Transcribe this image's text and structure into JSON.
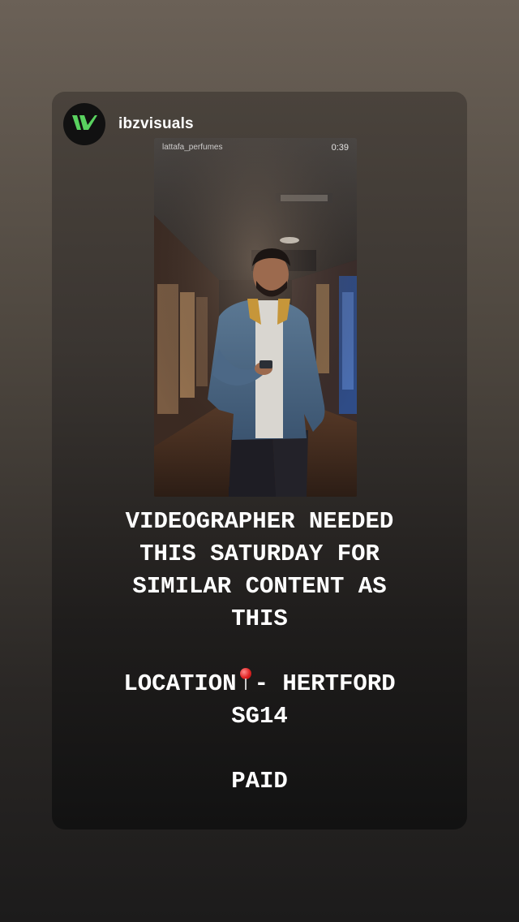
{
  "story": {
    "username": "ibzvisuals",
    "avatar_icon": "ibzvisuals-logo-icon",
    "avatar_color": "#59d25f"
  },
  "video": {
    "account": "lattafa_perfumes",
    "time": "0:39"
  },
  "caption": {
    "line1": "VIDEOGRAPHER NEEDED",
    "line2": "THIS SATURDAY FOR",
    "line3": "SIMILAR CONTENT AS",
    "line4": "THIS",
    "location_prefix": "LOCATION",
    "location_emoji": "round-pushpin-icon",
    "location_suffix": "- HERTFORD",
    "line6": "SG14",
    "line7": "PAID"
  }
}
